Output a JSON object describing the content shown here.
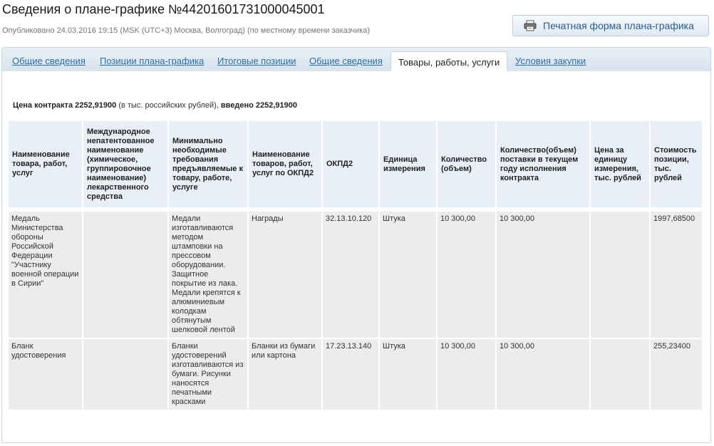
{
  "header": {
    "title": "Сведения о плане-графике №44201601731000045001",
    "published": "Опубликовано 24.03.2016 19:15 (MSK (UTC+3) Москва, Волгоград) (по местному времени заказчика)",
    "print_button": "Печатная форма плана-графика"
  },
  "tabs": [
    {
      "label": "Общие сведения"
    },
    {
      "label": "Позиции плана-графика"
    },
    {
      "label": "Итоговые позиции"
    },
    {
      "label": "Общие сведения"
    },
    {
      "label": "Товары, работы, услуги",
      "active": true
    },
    {
      "label": "Условия закупки"
    }
  ],
  "price": {
    "label": "Цена контракта",
    "value": "2252,91900",
    "unit": "(в тыс. российских рублей),",
    "entered_label": "введено",
    "entered_value": "2252,91900"
  },
  "table": {
    "headers": [
      "Наименование товара, работ, услуг",
      "Международное непатентованное наименование (химическое, группировочное наименование) лекарственного средства",
      "Минимально необходимые требования предъявляемые к товару, работе, услуге",
      "Наименование товаров, работ, услуг по ОКПД2",
      "ОКПД2",
      "Единица измерения",
      "Количество (объем)",
      "Количество(объем) поставки в текущем году исполнения контракта",
      "Цена за единицу измерения, тыс. рублей",
      "Стоимость позиции, тыс. рублей"
    ],
    "rows": [
      [
        "Медаль Министерства обороны Российской Федерации \"Участнику военной операции в Сирии\"",
        "",
        "Медали изготавливаются методом штамповки на прессовом оборудовании. Защитное покрытие из лака. Медали крепятся к алюминиевым колодкам обтянутым шелковой лентой",
        "Награды",
        "32.13.10.120",
        "Штука",
        "10 300,00",
        "10 300,00",
        "",
        "1997,68500"
      ],
      [
        "Бланк удостоверения",
        "",
        "Бланки удостоверений изготавливаются из бумаги. Рисунки наносятся печатными красками",
        "Бланки из бумаги или картона",
        "17.23.13.140",
        "Штука",
        "10 300,00",
        "10 300,00",
        "",
        "255,23400"
      ]
    ]
  }
}
